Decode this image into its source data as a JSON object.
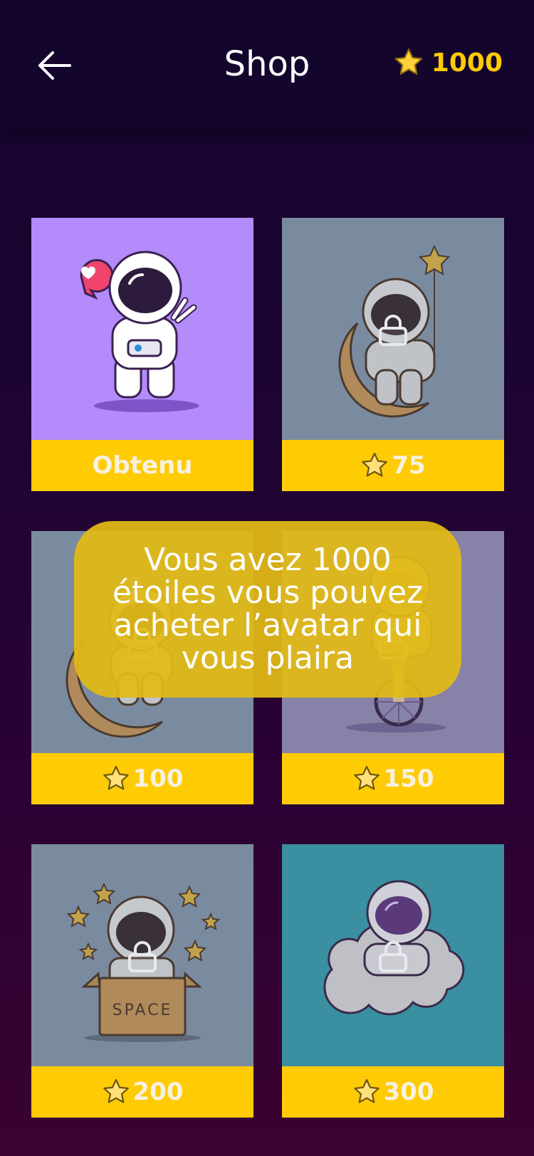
{
  "header": {
    "title": "Shop",
    "balance": "1000",
    "back_icon": "arrow-left-icon",
    "star_icon": "star-icon"
  },
  "cards": [
    {
      "price": "Obtenu",
      "status": "owned",
      "avatar": "astronaut-peace-sign-heart"
    },
    {
      "price": "75",
      "status": "locked",
      "avatar": "astronaut-on-moon-with-star-balloon"
    },
    {
      "price": "100",
      "status": "locked",
      "avatar": "astronaut-on-moon"
    },
    {
      "price": "150",
      "status": "locked",
      "avatar": "astronaut-on-unicycle"
    },
    {
      "price": "200",
      "status": "locked",
      "avatar": "astronaut-in-space-box"
    },
    {
      "price": "300",
      "status": "locked",
      "avatar": "astronaut-on-cloud"
    }
  ],
  "box_text": "SPACE",
  "toast": "Vous avez 1000 étoiles vous pouvez acheter l’avatar qui vous plaira",
  "colors": {
    "accent": "#ffcb05",
    "header_bg": "#14052c",
    "owned_card": "#b38bfa",
    "locked_card": "#7a8ba0",
    "teal_card": "#3a8fa0"
  }
}
